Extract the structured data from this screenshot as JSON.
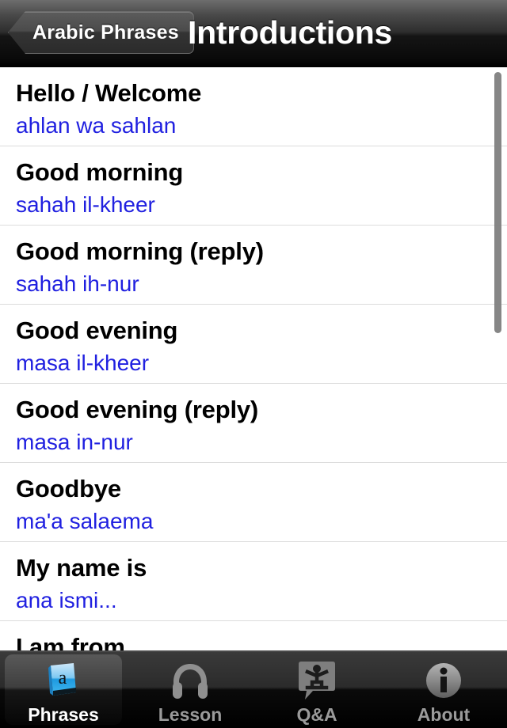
{
  "navbar": {
    "back_label": "Arabic Phrases",
    "title": "Introductions"
  },
  "list": {
    "rows": [
      {
        "english": "Hello / Welcome",
        "transliteration": "ahlan wa sahlan"
      },
      {
        "english": "Good morning",
        "transliteration": "sahah il-kheer"
      },
      {
        "english": "Good morning (reply)",
        "transliteration": "sahah ih-nur"
      },
      {
        "english": "Good evening",
        "transliteration": "masa il-kheer"
      },
      {
        "english": "Good evening (reply)",
        "transliteration": "masa in-nur"
      },
      {
        "english": "Goodbye",
        "transliteration": "ma'a salaema"
      },
      {
        "english": "My name is",
        "transliteration": "ana ismi..."
      },
      {
        "english": "I am from...",
        "transliteration": ""
      }
    ]
  },
  "tabbar": {
    "tabs": [
      {
        "label": "Phrases",
        "icon": "book-icon",
        "active": true
      },
      {
        "label": "Lesson",
        "icon": "headphones-icon",
        "active": false
      },
      {
        "label": "Q&A",
        "icon": "speech-bubble-person-icon",
        "active": false
      },
      {
        "label": "About",
        "icon": "info-circle-icon",
        "active": false
      }
    ]
  },
  "colors": {
    "transliteration": "#2020e0",
    "navbar_dark": "#0a0a0a",
    "accent_blue": "#35a8e8"
  }
}
